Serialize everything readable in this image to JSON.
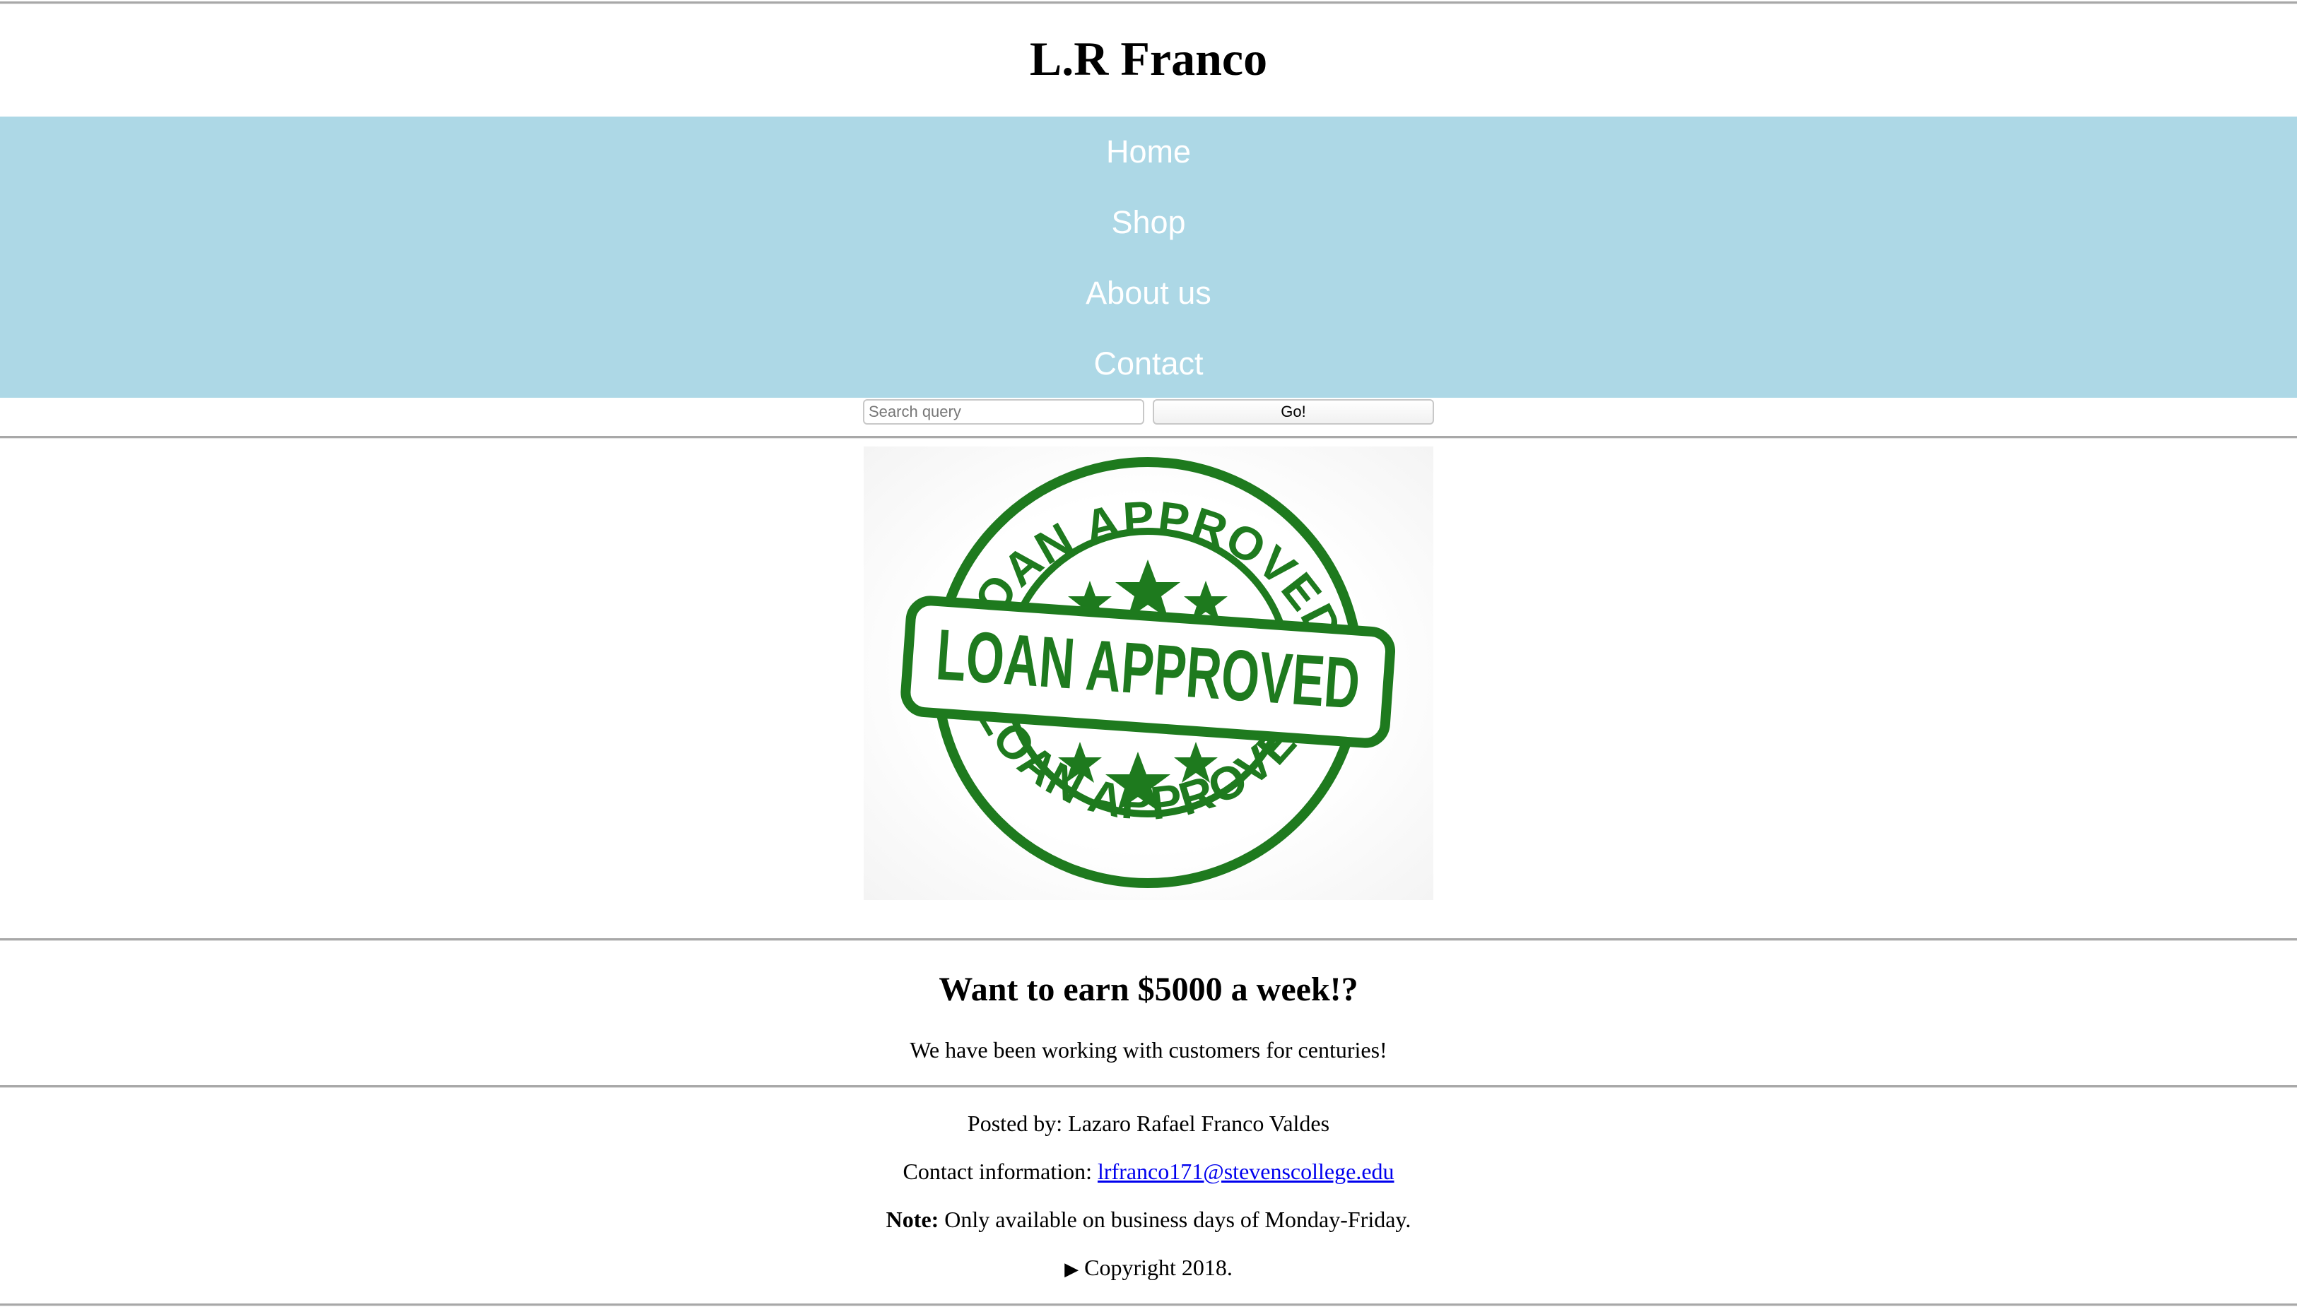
{
  "header": {
    "title": "L.R Franco"
  },
  "nav": {
    "items": [
      {
        "label": "Home"
      },
      {
        "label": "Shop"
      },
      {
        "label": "About us"
      },
      {
        "label": "Contact"
      }
    ],
    "background_color": "#add8e6",
    "text_color": "#ffffff"
  },
  "search": {
    "placeholder": "Search query",
    "value": "",
    "button_label": "Go!"
  },
  "hero": {
    "stamp_text": "LOAN APPROVED",
    "stamp_color": "#1e7a1e"
  },
  "promo": {
    "headline": "Want to earn $5000 a week!?",
    "subtext": "We have been working with customers for centuries!"
  },
  "footer": {
    "posted_by": "Posted by: Lazaro Rafael Franco Valdes",
    "contact_label": "Contact information: ",
    "contact_email": "lrfranco171@stevenscollege.edu",
    "note_label": "Note:",
    "note_text": " Only available on business days of Monday-Friday.",
    "copyright_marker": "▶",
    "copyright_text": " Copyright 2018."
  }
}
